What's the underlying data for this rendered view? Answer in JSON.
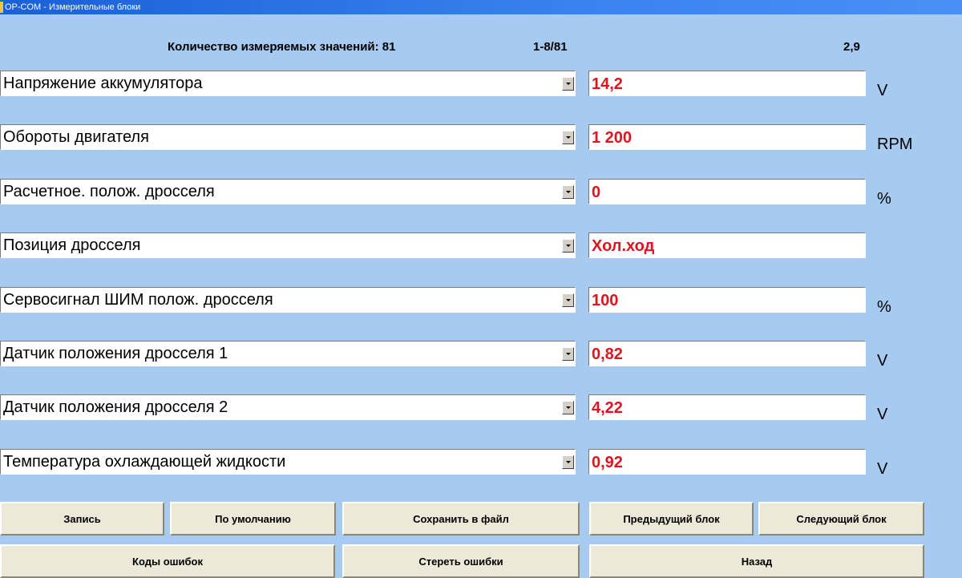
{
  "window": {
    "title": "OP-COM - Измерительные блоки"
  },
  "header": {
    "count_text": "Количество измеряемых значений: 81",
    "page_text": "1-8/81",
    "rate_text": "2,9"
  },
  "rows": [
    {
      "label": "Напряжение аккумулятора",
      "value": "14,2",
      "unit": "V"
    },
    {
      "label": "Обороты двигателя",
      "value": "1 200",
      "unit": "RPM"
    },
    {
      "label": "Расчетное. полож. дросселя",
      "value": "0",
      "unit": "%"
    },
    {
      "label": "Позиция дросселя",
      "value": "Хол.ход",
      "unit": ""
    },
    {
      "label": "Сервосигнал ШИМ полож. дросселя",
      "value": "100",
      "unit": "%"
    },
    {
      "label": "Датчик положения дросселя 1",
      "value": "0,82",
      "unit": "V"
    },
    {
      "label": "Датчик положения дросселя 2",
      "value": "4,22",
      "unit": "V"
    },
    {
      "label": "Температура охлаждающей жидкости",
      "value": "0,92",
      "unit": "V"
    }
  ],
  "buttons": {
    "record": "Запись",
    "defaults": "По умолчанию",
    "save_file": "Сохранить в файл",
    "prev_block": "Предыдущий блок",
    "next_block": "Следующий блок",
    "error_codes": "Коды ошибок",
    "clear_errors": "Стереть ошибки",
    "back": "Назад"
  },
  "colors": {
    "background": "#a6caf0",
    "value_text": "#e0141e",
    "button_face": "#ece9d8"
  },
  "icons": {
    "dropdown": "chevron-down-icon",
    "app": "app-icon"
  }
}
